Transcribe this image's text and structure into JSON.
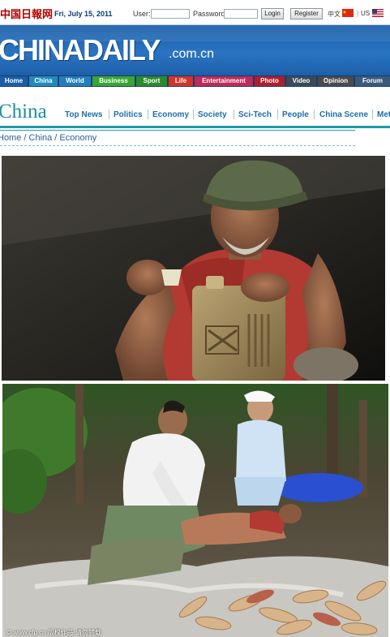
{
  "header": {
    "china_logo": "中国日報网",
    "date": "Fri, July 15, 2011",
    "user_label": "User:",
    "password_label": "Password:",
    "login_label": "Login",
    "register_label": "Register",
    "lang_cn": "中文",
    "lang_us": "US"
  },
  "masthead": {
    "logo": "CHINADAILY",
    "domain": ".com.cn"
  },
  "nav": {
    "items": [
      {
        "label": "Home",
        "color": "#1a5ea8"
      },
      {
        "label": "China",
        "color": "#1f8cbf"
      },
      {
        "label": "World",
        "color": "#1f7fbf"
      },
      {
        "label": "Business",
        "color": "#3aa632"
      },
      {
        "label": "Sport",
        "color": "#2b8a2b"
      },
      {
        "label": "Life",
        "color": "#d4332a"
      },
      {
        "label": "Entertainment",
        "color": "#c02a58"
      },
      {
        "label": "Photo",
        "color": "#b01e2e"
      },
      {
        "label": "Video",
        "color": "#3a4a5a"
      },
      {
        "label": "Opinion",
        "color": "#4a4a4a"
      },
      {
        "label": "Forum",
        "color": "#3a5a7a"
      }
    ]
  },
  "section": {
    "title": "China",
    "items": [
      "Top News",
      "Politics",
      "Economy",
      "Society",
      "Sci-Tech",
      "People",
      "China Scene",
      "Met"
    ]
  },
  "breadcrumb": "Home / China / Economy",
  "photo2_watermark": "© www.cfp.cn 版权作品 请勿转载",
  "colors": {
    "accent": "#1f9aa8",
    "brand_blue": "#1a5ea8",
    "nav_dark": "#173d6b"
  }
}
